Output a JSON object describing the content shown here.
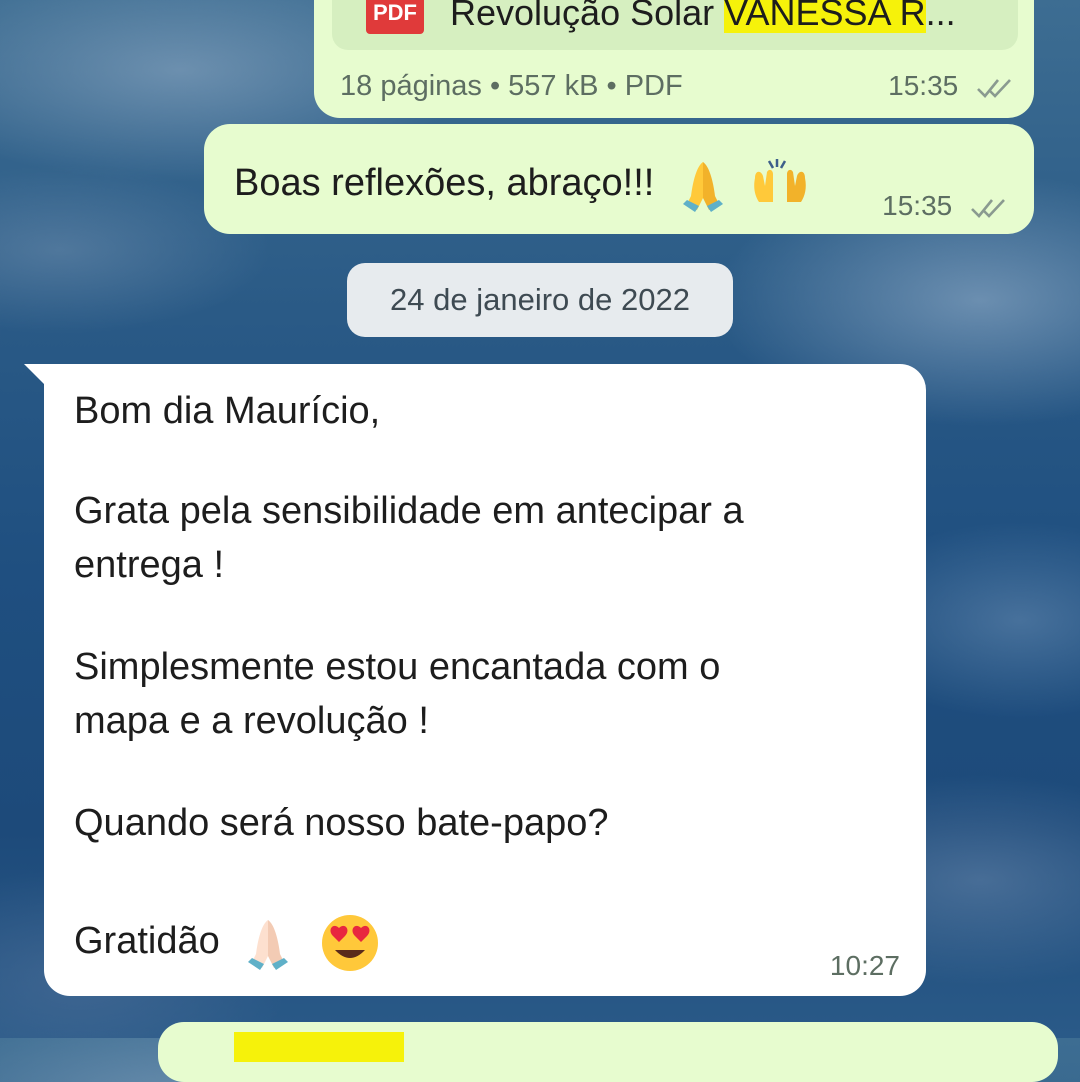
{
  "messages": {
    "document": {
      "icon": "pdf-icon",
      "badge": "PDF",
      "name_prefix": "Revolução Solar ",
      "name_highlight": "VANESSA R",
      "name_suffix": "...",
      "meta": "18 páginas • 557 kB • PDF",
      "time": "15:35"
    },
    "outgoing_text": {
      "text": "Boas reflexões, abraço!!!",
      "emojis": [
        "folded-hands-emoji",
        "raising-hands-emoji"
      ],
      "time": "15:35"
    },
    "date_separator": "24 de janeiro de 2022",
    "incoming_text": {
      "lines": [
        "Bom dia Maurício,",
        "Grata pela sensibilidade em antecipar a",
        "entrega !",
        "Simplesmente estou encantada com o",
        "mapa e a revolução !",
        "Quando será nosso bate-papo?",
        "Gratidão"
      ],
      "emojis": [
        "folded-hands-light-emoji",
        "heart-eyes-emoji"
      ],
      "time": "10:27"
    }
  },
  "colors": {
    "outgoing_bubble": "#e7fccf",
    "incoming_bubble": "#ffffff",
    "highlight": "#f6f20a",
    "read_ticks": "#8a9a90"
  }
}
